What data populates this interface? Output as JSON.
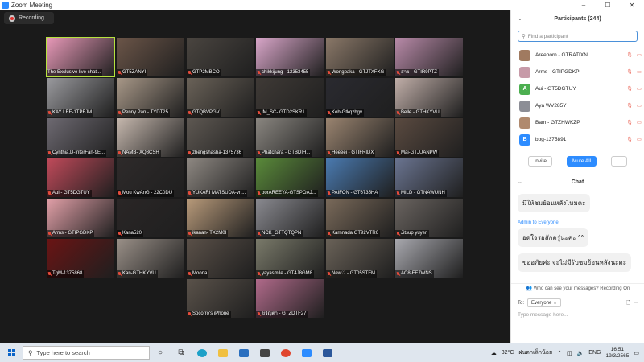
{
  "window": {
    "title": "Zoom Meeting",
    "minimize": "–",
    "maximize": "☐",
    "close": "✕"
  },
  "recording": {
    "label": "Recording..."
  },
  "tiles": [
    {
      "label": "The Exclusive live chat...",
      "bg": "#e899b8",
      "active": true,
      "muted": false
    },
    {
      "label": "GT5ZANYI",
      "bg": "#6b5548",
      "muted": true
    },
    {
      "label": "GTP2MBCO",
      "bg": "#4a4540",
      "muted": true
    },
    {
      "label": "chikkijung - 12353455",
      "bg": "#d9a6c9",
      "muted": true
    },
    {
      "label": "Wongpaka - GTJTXFXG",
      "bg": "#8a7868",
      "muted": true
    },
    {
      "label": "สาย - GTIR9PTZ",
      "bg": "#b88aa8",
      "muted": true
    },
    {
      "label": "KAY LEE-1TPFJM",
      "bg": "#9a9a9e",
      "muted": true
    },
    {
      "label": "Penny Pan - TYDT25",
      "bg": "#a89888",
      "muted": true
    },
    {
      "label": "GTQBVPGV",
      "bg": "#6a6258",
      "muted": true
    },
    {
      "label": "IM_SC- GTD2SKR1",
      "bg": "#3f3a36",
      "muted": true
    },
    {
      "label": "Kob-Gtkqzbgv",
      "bg": "#2a2a30",
      "muted": true
    },
    {
      "label": "Belle - GTHKYVU",
      "bg": "#c0aea8",
      "muted": true
    },
    {
      "label": "Cynthia.D-InterFan-9E...",
      "bg": "#6e6a72",
      "muted": true
    },
    {
      "label": "NAMB- XQ8CSH",
      "bg": "#c6b8ae",
      "muted": true
    },
    {
      "label": "zhengshasha-1375736",
      "bg": "#5e5852",
      "muted": true
    },
    {
      "label": "Phatchara - GTBDIH...",
      "bg": "#8a8680",
      "muted": true
    },
    {
      "label": "Heeeei - GTIFRIDX",
      "bg": "#9a8470",
      "muted": true
    },
    {
      "label": "Mai-GTJUANPW",
      "bg": "#5a4a40",
      "muted": true
    },
    {
      "label": "Aui - GT5DGTUY",
      "bg": "#c04a5a",
      "muted": true
    },
    {
      "label": "Mou KwAnG - 22C0DU",
      "bg": "#2e2a2a",
      "muted": true
    },
    {
      "label": "YUKARI MATSUDA-vn...",
      "bg": "#8e8882",
      "muted": true
    },
    {
      "label": "porAREEYA-GTSPOAJ...",
      "bg": "#5a8a3a",
      "muted": true
    },
    {
      "label": "PAIFON - GT6735HA",
      "bg": "#4a7ab0",
      "muted": true
    },
    {
      "label": "MILD - GTNAWUNH",
      "bg": "#6a7490",
      "muted": true
    },
    {
      "label": "Arms - GTIPGDKP",
      "bg": "#e2a0a8",
      "muted": true
    },
    {
      "label": "Kana520",
      "bg": "#2a2626",
      "muted": true
    },
    {
      "label": "ikanan- TX2M0I",
      "bg": "#b89a7a",
      "muted": true
    },
    {
      "label": "NCK_GTTQTQPN",
      "bg": "#8a8a90",
      "muted": true
    },
    {
      "label": "Karnnada GT92VTR6",
      "bg": "#7a6a5a",
      "muted": true
    },
    {
      "label": "Jitsup yuyen",
      "bg": "#6a6460",
      "muted": true
    },
    {
      "label": "TgM-1375868",
      "bg": "#6a1414",
      "muted": true
    },
    {
      "label": "Kan-GTHKYVU",
      "bg": "#9a9088",
      "muted": true
    },
    {
      "label": "Moona",
      "bg": "#5a5048",
      "muted": true
    },
    {
      "label": "yayasmile - GT4J8GM8",
      "bg": "#7a7a6a",
      "muted": true
    },
    {
      "label": "New♡ - GT05STFM",
      "bg": "#6a6258",
      "muted": true
    },
    {
      "label": "AC8-FE7WNS",
      "bg": "#a8a8ae",
      "muted": true
    },
    {
      "label": "Socorro's iPhone",
      "bg": "#5a524a",
      "muted": true
    },
    {
      "label": "ขวัญตา - GTZDTF27",
      "bg": "#b06a8a",
      "muted": true
    }
  ],
  "participants": {
    "title": "Participants (244)",
    "search_placeholder": "Find a participant",
    "items": [
      {
        "name": "Areeporn - GTRATIXN",
        "initial": "",
        "color": "#a07a60"
      },
      {
        "name": "Arms - GTIPGDKP",
        "initial": "",
        "color": "#c79aa8"
      },
      {
        "name": "Aui - GT5DGTUY",
        "initial": "A",
        "color": "#4caf50"
      },
      {
        "name": "Aya WV285Y",
        "initial": "",
        "color": "#8c8e96"
      },
      {
        "name": "Bam - GTZHWKZP",
        "initial": "",
        "color": "#b08a6e"
      },
      {
        "name": "bbg-1375891",
        "initial": "B",
        "color": "#2d8cff"
      }
    ],
    "invite": "Invite",
    "mute_all": "Mute All",
    "more": "..."
  },
  "chat": {
    "title": "Chat",
    "messages": [
      {
        "sender": "",
        "text": "มีให้ชมย้อนหลังไหมคะ"
      },
      {
        "sender": "Admin to Everyone",
        "text": "อดใจรอสักครู่นะคะ ^^"
      },
      {
        "sender": "",
        "text": "ขออภัยค่ะ จะไม่มีรับชมย้อนหลังนะคะ"
      }
    ],
    "who_can_see": "Who can see your messages? Recording On",
    "to_label": "To:",
    "to_value": "Everyone",
    "input_placeholder": "Type message here..."
  },
  "taskbar": {
    "search_placeholder": "Type here to search",
    "weather": "32°C",
    "weather_desc": "ฝนตกเล็กน้อย",
    "lang": "ENG",
    "time": "16:51",
    "date": "19/3/2565"
  }
}
